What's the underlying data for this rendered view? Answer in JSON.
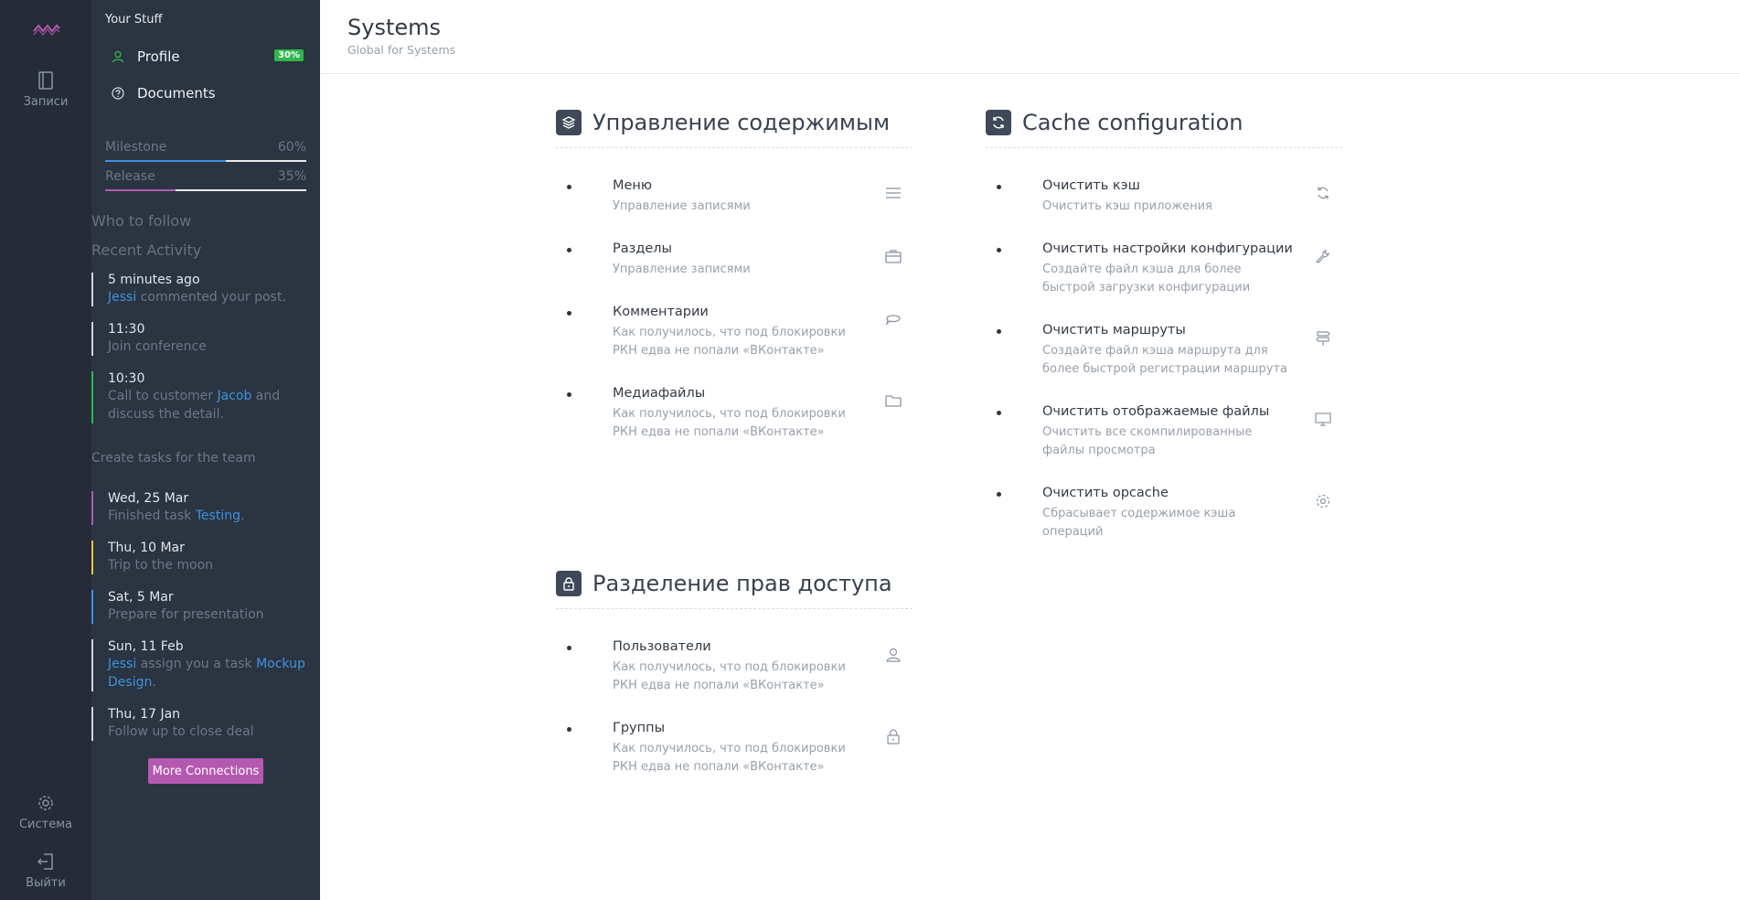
{
  "rail": {
    "records_label": "Записи",
    "system_label": "Система",
    "logout_label": "Выйти"
  },
  "sidebar": {
    "your_stuff": "Your Stuff",
    "profile": {
      "label": "Profile",
      "badge": "30%"
    },
    "documents": {
      "label": "Documents"
    },
    "milestone": {
      "label": "Milestone",
      "value": "60%",
      "fraction": 0.6,
      "color": "#3d8ee6"
    },
    "release": {
      "label": "Release",
      "value": "35%",
      "fraction": 0.35,
      "color": "#b459b0"
    },
    "who_to_follow": "Who to follow",
    "recent_activity": "Recent Activity",
    "activity": [
      {
        "time": "5 minutes ago",
        "link": "Jessi",
        "text": " commented your post.",
        "color": "#d2d6dc"
      },
      {
        "time": "11:30",
        "text": "Join conference",
        "color": "#d2d6dc"
      },
      {
        "time": "10:30",
        "pre": "Call to customer ",
        "link": "Jacob",
        "post": " and discuss the detail.",
        "color": "#2eb84b"
      },
      {
        "plain": "Create tasks for the team"
      },
      {
        "time": "Wed, 25 Mar",
        "pre": "Finished task ",
        "link": "Testing",
        "post": ".",
        "color": "#b459b0"
      },
      {
        "time": "Thu, 10 Mar",
        "text": "Trip to the moon",
        "color": "#f0c23e"
      },
      {
        "time": "Sat, 5 Mar",
        "text": "Prepare for presentation",
        "color": "#3d8ee6"
      },
      {
        "time": "Sun, 11 Feb",
        "link": "Jessi",
        "mid": " assign you a task ",
        "link2": "Mockup Design",
        "post": ".",
        "color": "#d2d6dc"
      },
      {
        "time": "Thu, 17 Jan",
        "text": "Follow up to close deal",
        "color": "#d2d6dc"
      }
    ],
    "more_connections": "More Connections"
  },
  "header": {
    "title": "Systems",
    "subtitle": "Global for Systems"
  },
  "content_panel": {
    "title": "Управление содержимым",
    "items": [
      {
        "title": "Меню",
        "desc": "Управление записями",
        "icon": "menu-icon"
      },
      {
        "title": "Разделы",
        "desc": "Управление записями",
        "icon": "briefcase-icon"
      },
      {
        "title": "Комментарии",
        "desc": "Как получилось, что под блокировки РКН едва не попали «ВКонтакте»",
        "icon": "comments-icon"
      },
      {
        "title": "Медиафайлы",
        "desc": "Как получилось, что под блокировки РКН едва не попали «ВКонтакте»",
        "icon": "folder-icon"
      }
    ]
  },
  "cache_panel": {
    "title": "Cache configuration",
    "items": [
      {
        "title": "Очистить кэш",
        "desc": "Очистить кэш приложения",
        "icon": "refresh-icon"
      },
      {
        "title": "Очистить настройки конфигурации",
        "desc": "Создайте файл кэша для более быстрой загрузки конфигурации",
        "icon": "wrench-icon"
      },
      {
        "title": "Очистить маршруты",
        "desc": "Создайте файл кэша маршрута для более быстрой регистрации маршрута",
        "icon": "signpost-icon"
      },
      {
        "title": "Очистить отображаемые файлы",
        "desc": "Очистить все скомпилированные файлы просмотра",
        "icon": "monitor-icon"
      },
      {
        "title": "Очистить opcache",
        "desc": "Сбрасывает содержимое кэша операций",
        "icon": "gear-icon"
      }
    ]
  },
  "access_panel": {
    "title": "Разделение прав доступа",
    "items": [
      {
        "title": "Пользователи",
        "desc": "Как получилось, что под блокировки РКН едва не попали «ВКонтакте»",
        "icon": "user-icon"
      },
      {
        "title": "Группы",
        "desc": "Как получилось, что под блокировки РКН едва не попали «ВКонтакте»",
        "icon": "lock-icon"
      }
    ]
  }
}
